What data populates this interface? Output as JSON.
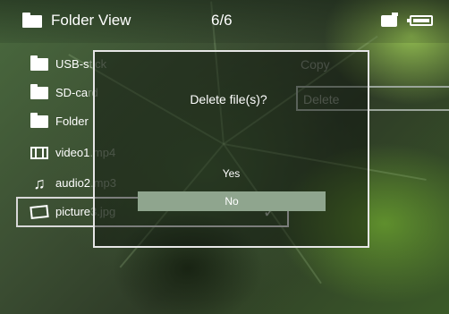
{
  "header": {
    "title": "Folder View",
    "count": "6/6",
    "left_icon": "folder-icon",
    "right_icons": [
      "sd-card-icon",
      "battery-icon"
    ]
  },
  "file_list": {
    "items": [
      {
        "icon": "folder-icon",
        "label": "USB-s",
        "dim": "tick"
      },
      {
        "icon": "folder-icon",
        "label": "SD-ca",
        "dim": "rd"
      },
      {
        "icon": "folder-icon",
        "label": "Folder",
        "dim": ""
      },
      {
        "icon": "film-icon",
        "label": "video1",
        "dim": ".mp4"
      },
      {
        "icon": "music-note-icon",
        "label": "audio2",
        "dim": ".mp3"
      },
      {
        "icon": "picture-icon",
        "label": "picture",
        "dim": "3.jpg",
        "selected": true
      }
    ]
  },
  "context_menu": {
    "copy_label": "Copy",
    "delete_label": "Delete"
  },
  "dialog": {
    "title": "Delete file(s)?",
    "yes_label": "Yes",
    "no_label": "No"
  },
  "selection_mark": "✓"
}
